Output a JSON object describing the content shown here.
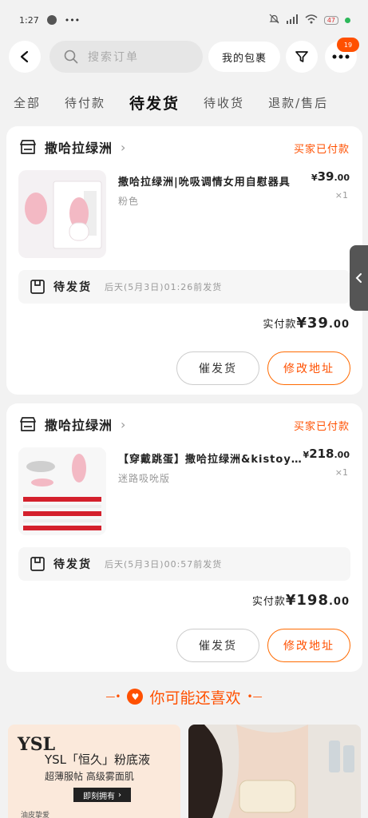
{
  "status": {
    "time": "1:27",
    "more": "•••",
    "network": "HD",
    "battery": "47"
  },
  "search": {
    "placeholder": "搜索订单"
  },
  "header": {
    "package_label": "我的包裹",
    "badge": "19"
  },
  "tabs": [
    {
      "label": "全部"
    },
    {
      "label": "待付款"
    },
    {
      "label": "待发货",
      "active": true
    },
    {
      "label": "待收货"
    },
    {
      "label": "退款/售后"
    }
  ],
  "orders": [
    {
      "shop": "撒哈拉绿洲",
      "status": "买家已付款",
      "title": "撒哈拉绿洲|吮吸调情女用自慰器具",
      "spec": "粉色",
      "price_symbol": "¥",
      "price_int": "39",
      "price_dec": ".00",
      "qty": "×1",
      "ship_label": "待发货",
      "ship_time": "后天(5月3日)01:26前发货",
      "paid_label": "实付款",
      "paid_symbol": "¥",
      "paid_int": "39",
      "paid_dec": ".00",
      "btn_remind": "催发货",
      "btn_modify": "修改地址"
    },
    {
      "shop": "撒哈拉绿洲",
      "status": "买家已付款",
      "title": "【穿戴跳蛋】撒哈拉绿洲&kistoy联名款",
      "spec": "迷路吸吮版",
      "price_symbol": "¥",
      "price_int": "218",
      "price_dec": ".00",
      "qty": "×1",
      "ship_label": "待发货",
      "ship_time": "后天(5月3日)00:57前发货",
      "paid_label": "实付款",
      "paid_symbol": "¥",
      "paid_int": "198",
      "paid_dec": ".00",
      "btn_remind": "催发货",
      "btn_modify": "修改地址"
    }
  ],
  "recommend": {
    "title": "你可能还喜欢",
    "ad": {
      "logo": "YSL",
      "title": "YSL「恒久」粉底液",
      "subtitle": "超薄服帖 高级雾面肌",
      "button": "即刻拥有",
      "footer": "油皮挚爱"
    }
  },
  "colors": {
    "accent": "#ff5000",
    "background": "#f2f2f2"
  }
}
